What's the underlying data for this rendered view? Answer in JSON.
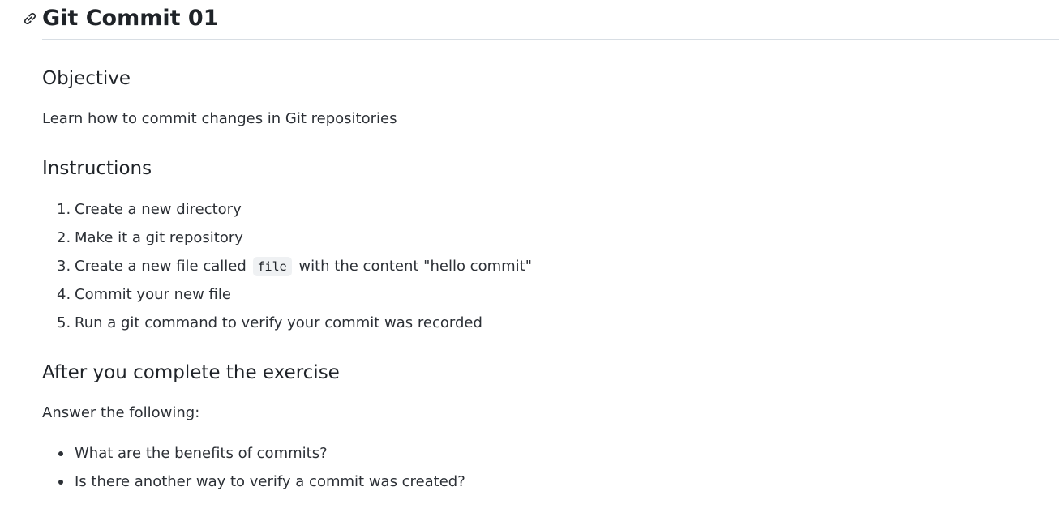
{
  "title": "Git Commit 01",
  "sections": {
    "objective": {
      "heading": "Objective",
      "text": "Learn how to commit changes in Git repositories"
    },
    "instructions": {
      "heading": "Instructions",
      "items": [
        {
          "num": "1.",
          "text": "Create a new directory"
        },
        {
          "num": "2.",
          "text": "Make it a git repository"
        },
        {
          "num": "3.",
          "before": "Create a new file called",
          "code": "file",
          "after": "with the content \"hello commit\""
        },
        {
          "num": "4.",
          "text": "Commit your new file"
        },
        {
          "num": "5.",
          "text": "Run a git command to verify your commit was recorded"
        }
      ]
    },
    "after": {
      "heading": "After you complete the exercise",
      "text": "Answer the following:",
      "questions": [
        "What are the benefits of commits?",
        "Is there another way to verify a commit was created?"
      ]
    }
  },
  "icons": {
    "anchor": "link-icon"
  }
}
